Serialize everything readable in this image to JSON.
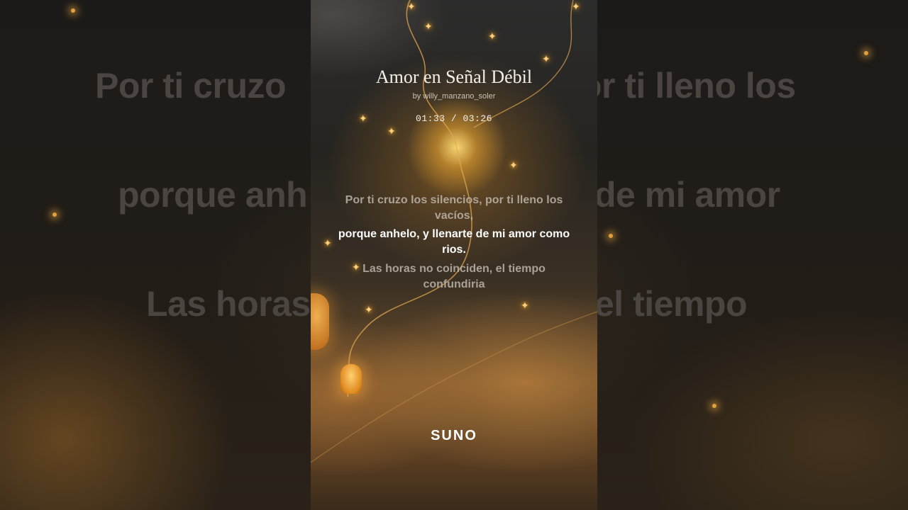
{
  "song": {
    "title": "Amor en Señal Débil",
    "author": "by willy_manzano_soler",
    "time_display": "01:33 / 03:26"
  },
  "lyrics": {
    "previous": "Por ti cruzo los silencios, por ti lleno los vacíos,",
    "current": "porque anhelo, y llenarte de mi amor como rios.",
    "next": "Las horas no coinciden, el tiempo confundiria"
  },
  "background_lyrics": {
    "line_1_left": "Por ti cruzo",
    "line_1_right": "or ti lleno los",
    "line_2_left": "porque anh",
    "line_2_right": "de mi amor",
    "line_3_left": "Las horas",
    "line_3_right": "el tiempo"
  },
  "brand": {
    "logo_text": "SUNO"
  },
  "colors": {
    "current_lyric": "#ffffff",
    "inactive_lyric": "#beb6ac",
    "glow": "#ffd27a"
  }
}
